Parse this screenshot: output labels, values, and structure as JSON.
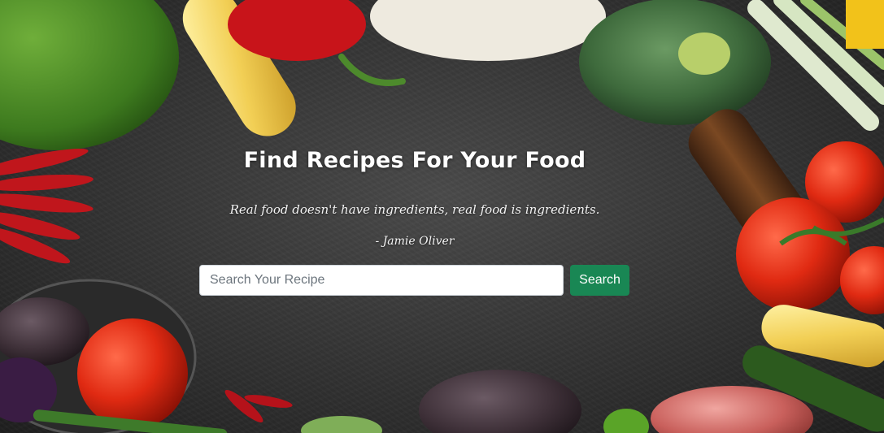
{
  "hero": {
    "title": "Find Recipes For Your Food",
    "quote": "Real food doesn't have ingredients, real food is ingredients.",
    "author": "- Jamie Oliver"
  },
  "search": {
    "placeholder": "Search Your Recipe",
    "value": "",
    "button_label": "Search"
  },
  "colors": {
    "button_bg": "#198754",
    "background": "#3b3b3b",
    "text": "#ffffff"
  }
}
